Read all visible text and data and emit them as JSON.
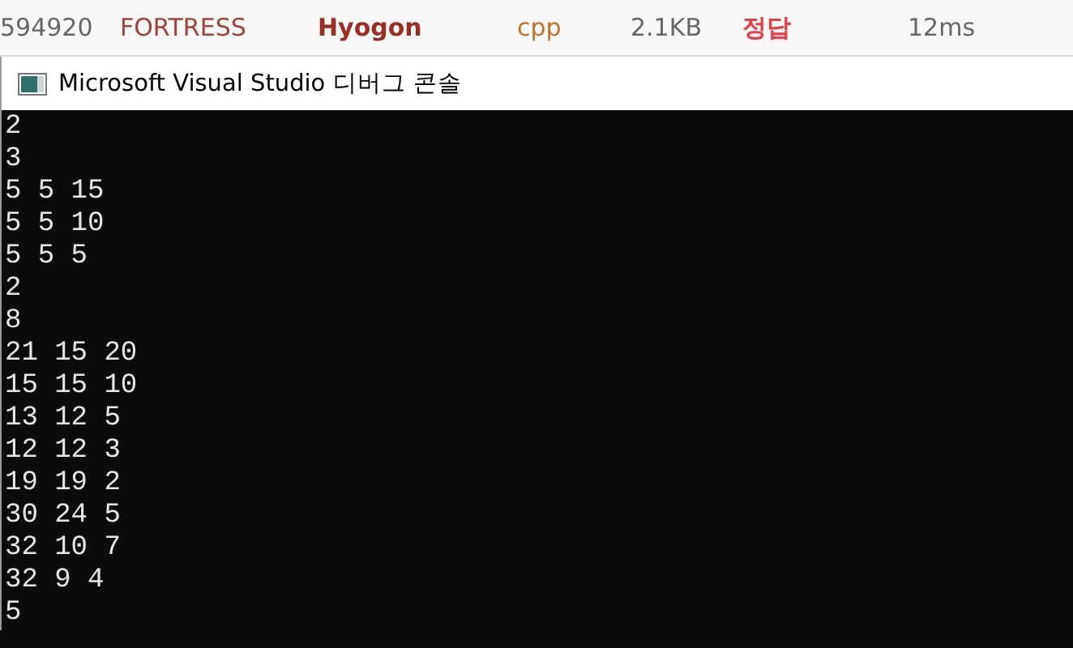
{
  "submission_row": {
    "id": "594920",
    "problem": "FORTRESS",
    "user": "Hyogon",
    "language": "cpp",
    "size": "2.1KB",
    "result": "정답",
    "time": "12ms"
  },
  "window": {
    "title": "Microsoft Visual Studio 디버그 콘솔"
  },
  "console_lines": [
    "2",
    "3",
    "5 5 15",
    "5 5 10",
    "5 5 5",
    "2",
    "8",
    "21 15 20",
    "15 15 10",
    "13 12 5",
    "12 12 3",
    "19 19 2",
    "30 24 5",
    "32 10 7",
    "32 9 4",
    "5"
  ]
}
